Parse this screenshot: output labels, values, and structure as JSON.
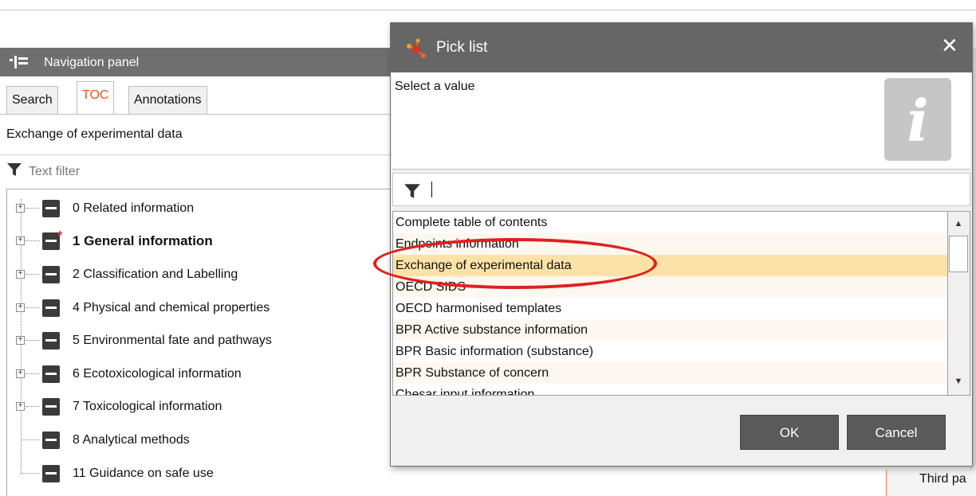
{
  "nav_panel": {
    "title": "Navigation panel",
    "tabs": [
      {
        "label": "Search"
      },
      {
        "label": "TOC",
        "active": true
      },
      {
        "label": "Annotations"
      }
    ],
    "toc_selection": "Exchange of experimental data",
    "filter_placeholder": "Text filter",
    "tree": [
      {
        "label": "0 Related information"
      },
      {
        "label": "1 General information",
        "bold": true,
        "required": true
      },
      {
        "label": "2 Classification and Labelling"
      },
      {
        "label": "4 Physical and chemical properties"
      },
      {
        "label": "5 Environmental fate and pathways"
      },
      {
        "label": "6 Ecotoxicological information"
      },
      {
        "label": "7 Toxicological information"
      },
      {
        "label": "8 Analytical methods"
      },
      {
        "label": "11 Guidance on safe use"
      }
    ]
  },
  "background_panel": {
    "partial_label": "Third pa"
  },
  "dialog": {
    "title": "Pick list",
    "close_symbol": "✕",
    "prompt": "Select a value",
    "info_glyph": "i",
    "filter_value": "",
    "items": [
      "Complete table of contents",
      "Endpoints information",
      "Exchange of experimental data",
      "OECD SIDS",
      "OECD harmonised templates",
      "BPR Active substance information",
      "BPR Basic information (substance)",
      "BPR Substance of concern",
      "Chesar input information"
    ],
    "selected_index": 2,
    "ok_label": "OK",
    "cancel_label": "Cancel"
  },
  "colors": {
    "header_bg": "#666666",
    "active_tab": "#e7541a",
    "selection": "#fde2a8",
    "annotation": "#e02020",
    "button_bg": "#5a5a5a"
  }
}
